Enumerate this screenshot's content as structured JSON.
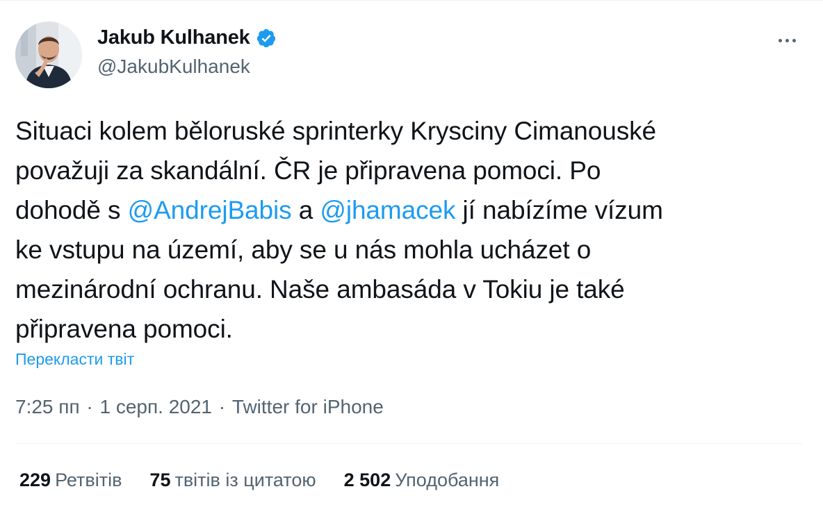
{
  "author": {
    "display_name": "Jakub Kulhanek",
    "handle": "@JakubKulhanek",
    "verified_icon": "verified-badge-icon",
    "avatar_icon": "profile-photo"
  },
  "more_icon": "more-horizontal-icon",
  "tweet": {
    "line1": "Situaci kolem běloruské sprinterky Krysciny Cimanouské",
    "line2": "považuji za skandální. ČR je připravena pomoci. Po",
    "line3_pre": "dohodě s ",
    "mention1": "@AndrejBabis",
    "line3_mid": " a ",
    "mention2": "@jhamacek",
    "line3_post": " jí nabízíme vízum",
    "line4": "ke vstupu na území, aby se u nás mohla ucházet o",
    "line5": "mezinárodní ochranu. Naše ambasáda v Tokiu je také",
    "line6": "připravena pomoci."
  },
  "translate_label": "Перекласти твіт",
  "meta": {
    "time": "7:25 пп",
    "separator": "·",
    "date": "1 серп. 2021",
    "source": "Twitter for iPhone"
  },
  "stats": {
    "retweets_count": "229",
    "retweets_label": "Ретвітів",
    "quotes_count": "75",
    "quotes_label": "твітів із цитатою",
    "likes_count": "2 502",
    "likes_label": "Уподобання"
  },
  "colors": {
    "link": "#1d9bf0",
    "secondary_text": "#536471",
    "primary_text": "#0f1419",
    "divider": "#eff3f4"
  }
}
